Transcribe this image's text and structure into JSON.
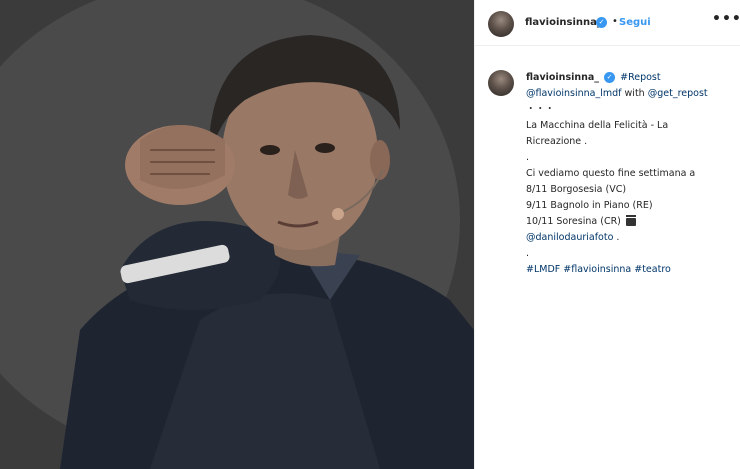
{
  "post": {
    "photo_alt": "photo",
    "header": {
      "username": "flavioinsinna_",
      "separator": "•",
      "follow_label": "Segui",
      "more_label": "•••"
    },
    "caption": {
      "username": "flavioinsinna_",
      "repost_tag": "#Repost",
      "repost_source": "@flavioinsinna_lmdf",
      "with_text": " with ",
      "via": "@get_repost",
      "dots1": "・・・",
      "title_line1": "La Macchina della Felicità - La",
      "title_line2": "Ricreazione .",
      "dot_a": ".",
      "intro": "Ci vediamo questo fine settimana a",
      "date1": "8/11 Borgosesia (VC)",
      "date2": "9/11 Bagnolo in Piano (RE)",
      "date3": "10/11 Soresina (CR)",
      "photo_credit": "@danilodauriafoto",
      "credit_suffix": " .",
      "dot_b": ".",
      "tag1": "#LMDF",
      "tag2": "#flavioinsinna",
      "tag3": "#teatro"
    }
  },
  "colors": {
    "link": "#003569",
    "follow": "#3897f0",
    "verified": "#3897f0",
    "text": "#262626"
  },
  "icons": [
    "verified-badge-icon",
    "more-options-icon",
    "clapperboard-icon"
  ]
}
